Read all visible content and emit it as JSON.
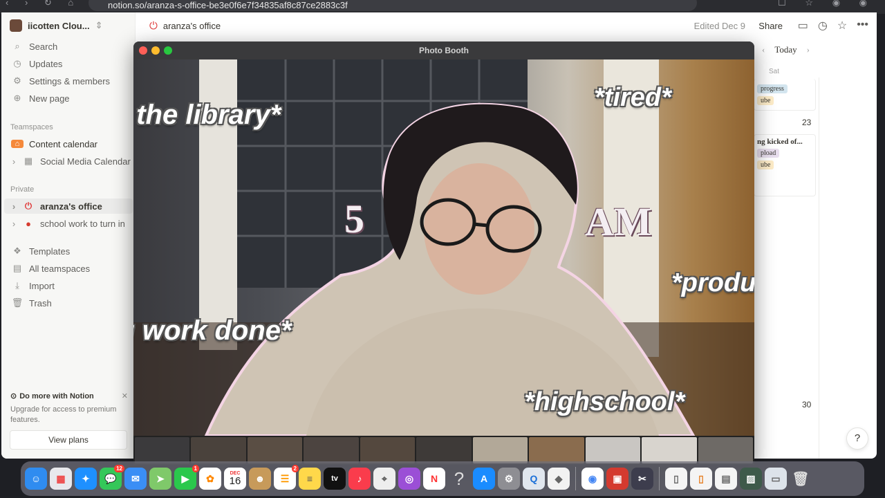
{
  "browser": {
    "url": "notion.so/aranza-s-office-be3e0f6e7f34835af8c87ce2883c3f"
  },
  "sidebar": {
    "workspace": "iicotten Clou...",
    "top_items": [
      {
        "label": "Search",
        "icon": "search-icon"
      },
      {
        "label": "Updates",
        "icon": "clock-icon"
      },
      {
        "label": "Settings & members",
        "icon": "gear-icon"
      },
      {
        "label": "New page",
        "icon": "plus-circle-icon"
      }
    ],
    "teamspaces_header": "Teamspaces",
    "teamspaces": [
      {
        "label": "Content calendar",
        "icon": "home-icon"
      },
      {
        "label": "Social Media Calendar",
        "icon": "calendar-icon"
      }
    ],
    "private_header": "Private",
    "private": [
      {
        "label": "aranza's office",
        "icon": "power-icon"
      },
      {
        "label": "school work to turn in",
        "icon": "apple-icon"
      }
    ],
    "bottom_items": [
      {
        "label": "Templates",
        "icon": "templates-icon"
      },
      {
        "label": "All teamspaces",
        "icon": "grid-icon"
      },
      {
        "label": "Import",
        "icon": "download-icon"
      },
      {
        "label": "Trash",
        "icon": "trash-icon"
      }
    ],
    "promo": {
      "title": "Do more with Notion",
      "text": "Upgrade for access to premium features.",
      "button": "View plans"
    }
  },
  "topbar": {
    "breadcrumb": "aranza's office",
    "edited": "Edited Dec 9",
    "share": "Share"
  },
  "calendar": {
    "today": "Today",
    "weekday": "Sat",
    "cell1": {
      "tag1": "progress",
      "tag2": "ube"
    },
    "day23": "23",
    "cell2": {
      "title": "ng kicked of...",
      "tag1": "pload",
      "tag2": "ube"
    },
    "day30": "30"
  },
  "help": "?",
  "photobooth": {
    "title": "Photo Booth",
    "thumb_count": 11
  },
  "captions": {
    "library": "*in the library*",
    "tired": "*tired*",
    "five": "5",
    "am": "AM",
    "productive": "*productive*",
    "work": "*getting work done*",
    "highschool": "*highschool*"
  },
  "dock": {
    "calendar_month": "DEC",
    "calendar_day": "16",
    "messages_badge": "12",
    "facetime_badge": "1",
    "reminders_badge": "2",
    "tv_label": "tv"
  },
  "colors": {
    "notion_red": "#e03e3e",
    "outline_pink": "#f4d4e4",
    "tag_blue": "#d3e5ef",
    "tag_yellow": "#fdecc8",
    "tag_purple": "#e8deee"
  }
}
